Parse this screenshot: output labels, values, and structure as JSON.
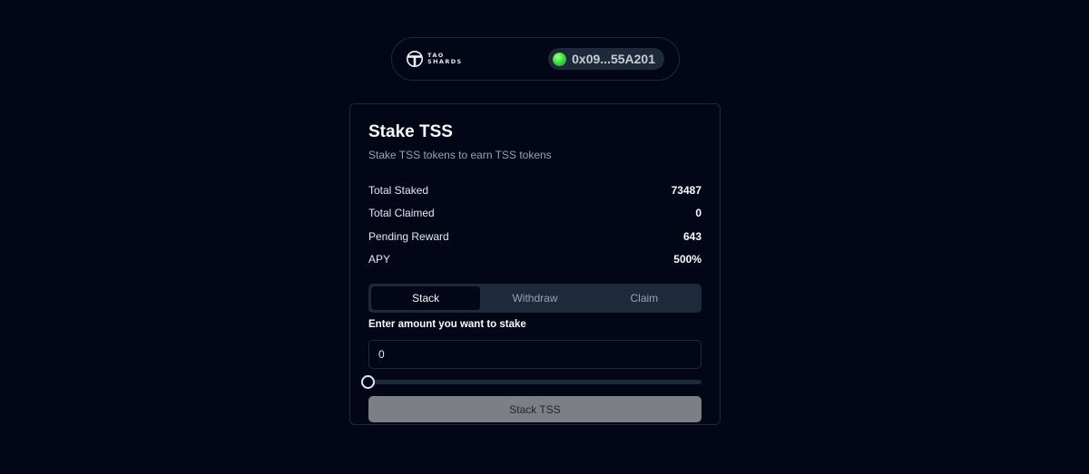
{
  "header": {
    "logo_line1": "TAO",
    "logo_line2": "SHARDS",
    "wallet_address": "0x09...55A201",
    "wallet_status_color": "#38e13a"
  },
  "stake_card": {
    "title": "Stake TSS",
    "subtitle": "Stake TSS tokens to earn TSS tokens",
    "stats": [
      {
        "label": "Total Staked",
        "value": "73487"
      },
      {
        "label": "Total Claimed",
        "value": "0"
      },
      {
        "label": "Pending Reward",
        "value": "643"
      },
      {
        "label": "APY",
        "value": "500%"
      }
    ],
    "tabs": [
      {
        "label": "Stack",
        "active": true
      },
      {
        "label": "Withdraw",
        "active": false
      },
      {
        "label": "Claim",
        "active": false
      }
    ],
    "amount_label": "Enter amount you want to stake",
    "amount_value": "0",
    "slider_value": 0,
    "submit_label": "Stack TSS"
  },
  "colors": {
    "background": "#020617",
    "surface": "#1e293b",
    "button_disabled": "#7d7f86"
  }
}
